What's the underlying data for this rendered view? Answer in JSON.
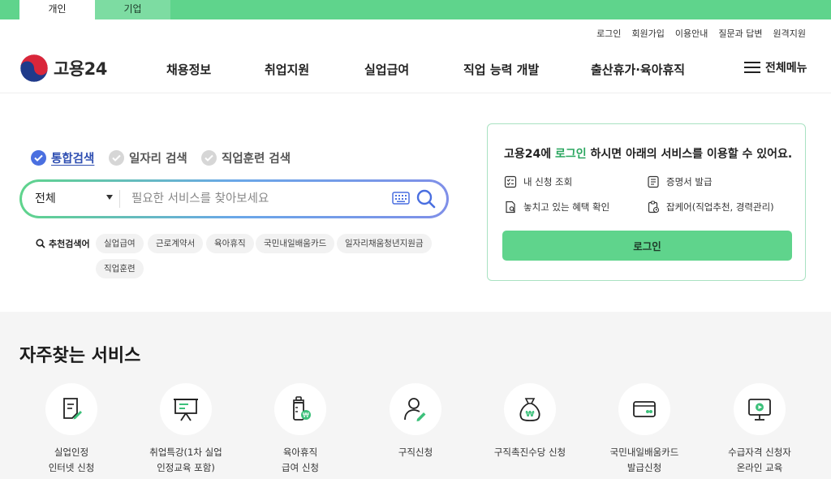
{
  "audience_tabs": {
    "personal": "개인",
    "corporate": "기업"
  },
  "utility_links": [
    "로그인",
    "회원가입",
    "이용안내",
    "질문과 답변",
    "원격지원"
  ],
  "logo": {
    "text": "고용24"
  },
  "gnb": [
    "채용정보",
    "취업지원",
    "실업급여",
    "직업 능력 개발",
    "출산휴가·육아휴직"
  ],
  "all_menu": "전체메뉴",
  "search": {
    "tabs": [
      "통합검색",
      "일자리 검색",
      "직업훈련 검색"
    ],
    "active_tab": 0,
    "scope": "전체",
    "placeholder": "필요한 서비스를 찾아보세요"
  },
  "recommend": {
    "label": "추천검색어",
    "keywords": [
      "실업급여",
      "근로계약서",
      "육아휴직",
      "국민내일배움카드",
      "일자리채움청년지원금",
      "직업훈련"
    ]
  },
  "login_card": {
    "title_pre": "고용24에 ",
    "title_hl": "로그인",
    "title_post": " 하시면 아래의 서비스를 이용할 수 있어요.",
    "services": [
      "내 신청 조회",
      "증명서 발급",
      "놓치고 있는 혜택 확인",
      "잡케어(직업추천, 경력관리)"
    ],
    "button": "로그인"
  },
  "frequent": {
    "title": "자주찾는 서비스",
    "items": [
      {
        "label": "실업인정\n인터넷 신청",
        "icon": "document-pen-icon"
      },
      {
        "label": "취업특강(1차 실업\n인정교육 포함)",
        "icon": "presentation-board-icon"
      },
      {
        "label": "육아휴직\n급여 신청",
        "icon": "baby-bottle-icon"
      },
      {
        "label": "구직신청",
        "icon": "person-pen-icon"
      },
      {
        "label": "구직촉진수당 신청",
        "icon": "money-bag-icon"
      },
      {
        "label": "국민내일배움카드\n발급신청",
        "icon": "card-icon"
      },
      {
        "label": "수급자격 신청자\n온라인 교육",
        "icon": "monitor-play-icon"
      }
    ]
  },
  "colors": {
    "brand_green": "#5fd48c",
    "link_blue": "#2f4fb2",
    "bg_gray": "#f5f5f5"
  }
}
